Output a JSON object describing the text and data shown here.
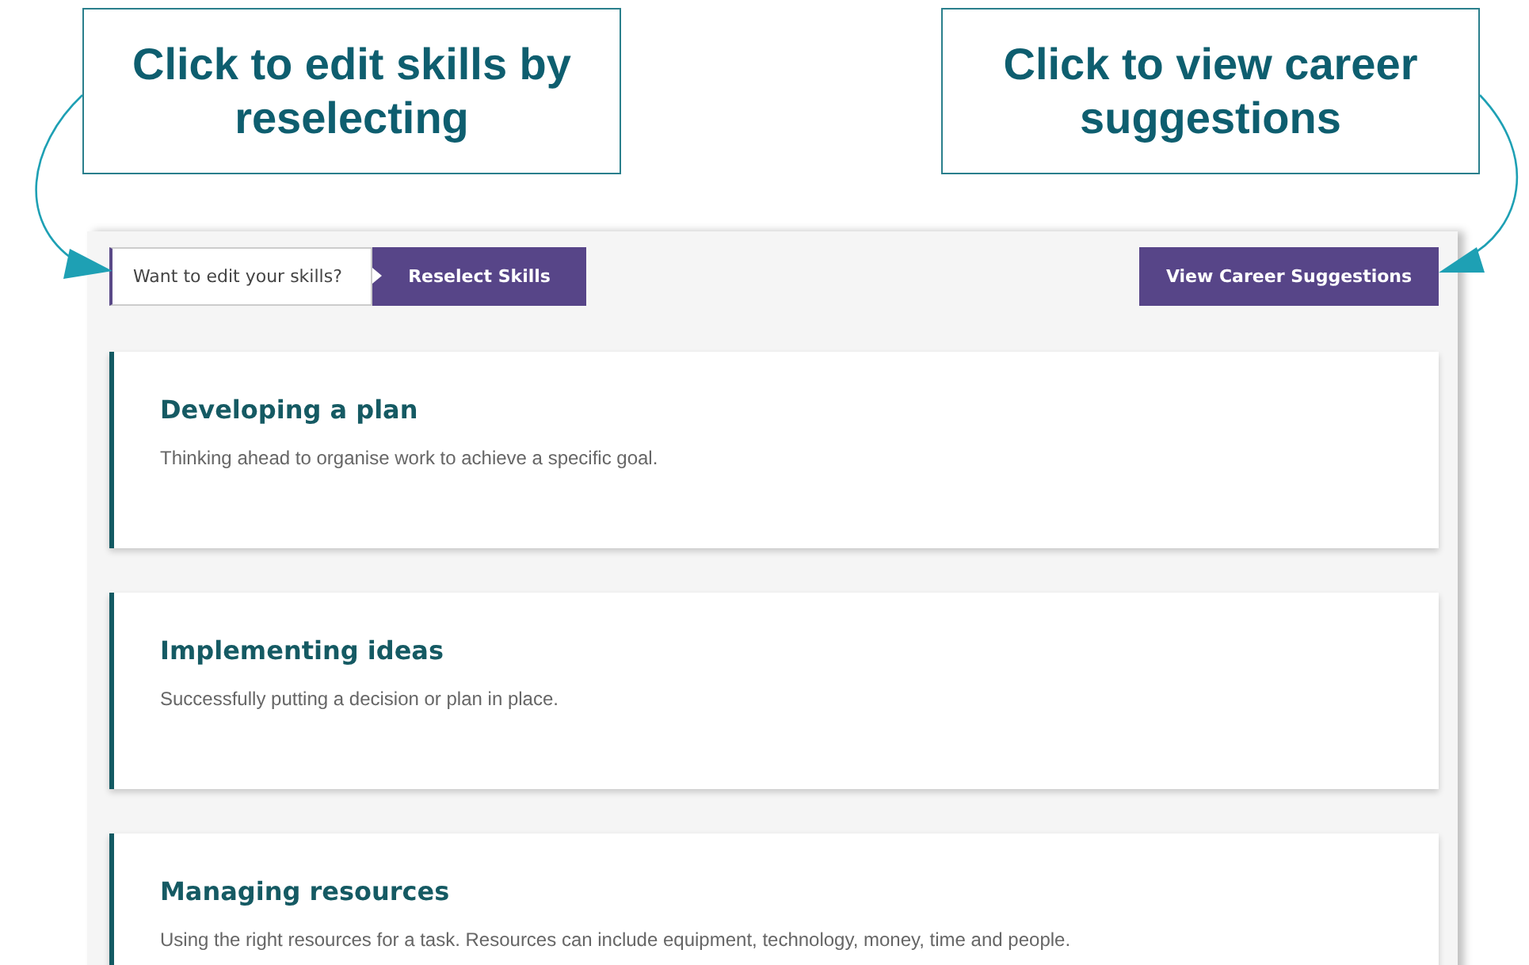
{
  "callouts": [
    {
      "text": "Click to edit skills by reselecting"
    },
    {
      "text": "Click to view career suggestions"
    }
  ],
  "toolbar": {
    "prompt": "Want to edit your skills?",
    "reselect_button": "Reselect Skills",
    "career_button": "View Career Suggestions"
  },
  "skills": [
    {
      "title": "Developing a plan",
      "description": "Thinking ahead to organise work to achieve a specific goal."
    },
    {
      "title": "Implementing ideas",
      "description": "Successfully putting a decision or plan in place."
    },
    {
      "title": "Managing resources",
      "description": "Using the right resources for a task. Resources can include equipment, technology, money, time and people."
    }
  ]
}
